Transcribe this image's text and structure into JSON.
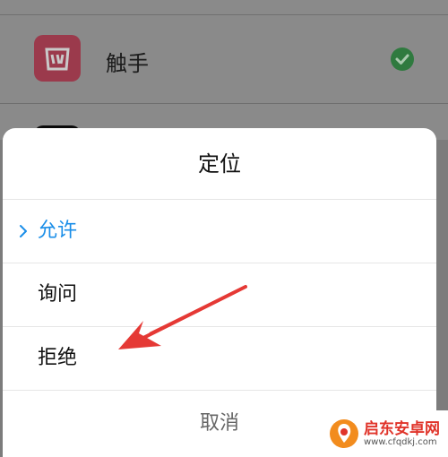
{
  "app_list": {
    "items": [
      {
        "name": "触手",
        "status": "allowed"
      }
    ]
  },
  "dialog": {
    "title": "定位",
    "options": [
      {
        "label": "允许",
        "selected": true
      },
      {
        "label": "询问",
        "selected": false
      },
      {
        "label": "拒绝",
        "selected": false
      }
    ],
    "cancel_label": "取消"
  },
  "watermark": {
    "name": "启东安卓网",
    "url": "www.cfqdkj.com"
  },
  "colors": {
    "accent": "#1a8ee8",
    "annotation": "#e53935",
    "check": "#2f7a3f"
  }
}
